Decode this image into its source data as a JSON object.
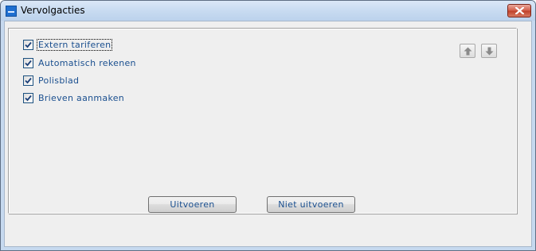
{
  "window": {
    "title": "Vervolgacties",
    "app_icon": "app-icon",
    "close_icon": "close-icon"
  },
  "checkboxes": [
    {
      "label": "Extern tariferen",
      "checked": true,
      "focused": true
    },
    {
      "label": "Automatisch rekenen",
      "checked": true,
      "focused": false
    },
    {
      "label": "Polisblad",
      "checked": true,
      "focused": false
    },
    {
      "label": "Brieven aanmaken",
      "checked": true,
      "focused": false
    }
  ],
  "reorder": {
    "up_icon": "arrow-up-icon",
    "down_icon": "arrow-down-icon"
  },
  "buttons": {
    "execute_label": "Uitvoeren",
    "skip_label": "Niet uitvoeren"
  },
  "colors": {
    "label_text": "#1a4f8f",
    "client_bg": "#efefef",
    "close_button": "#c0432c"
  }
}
